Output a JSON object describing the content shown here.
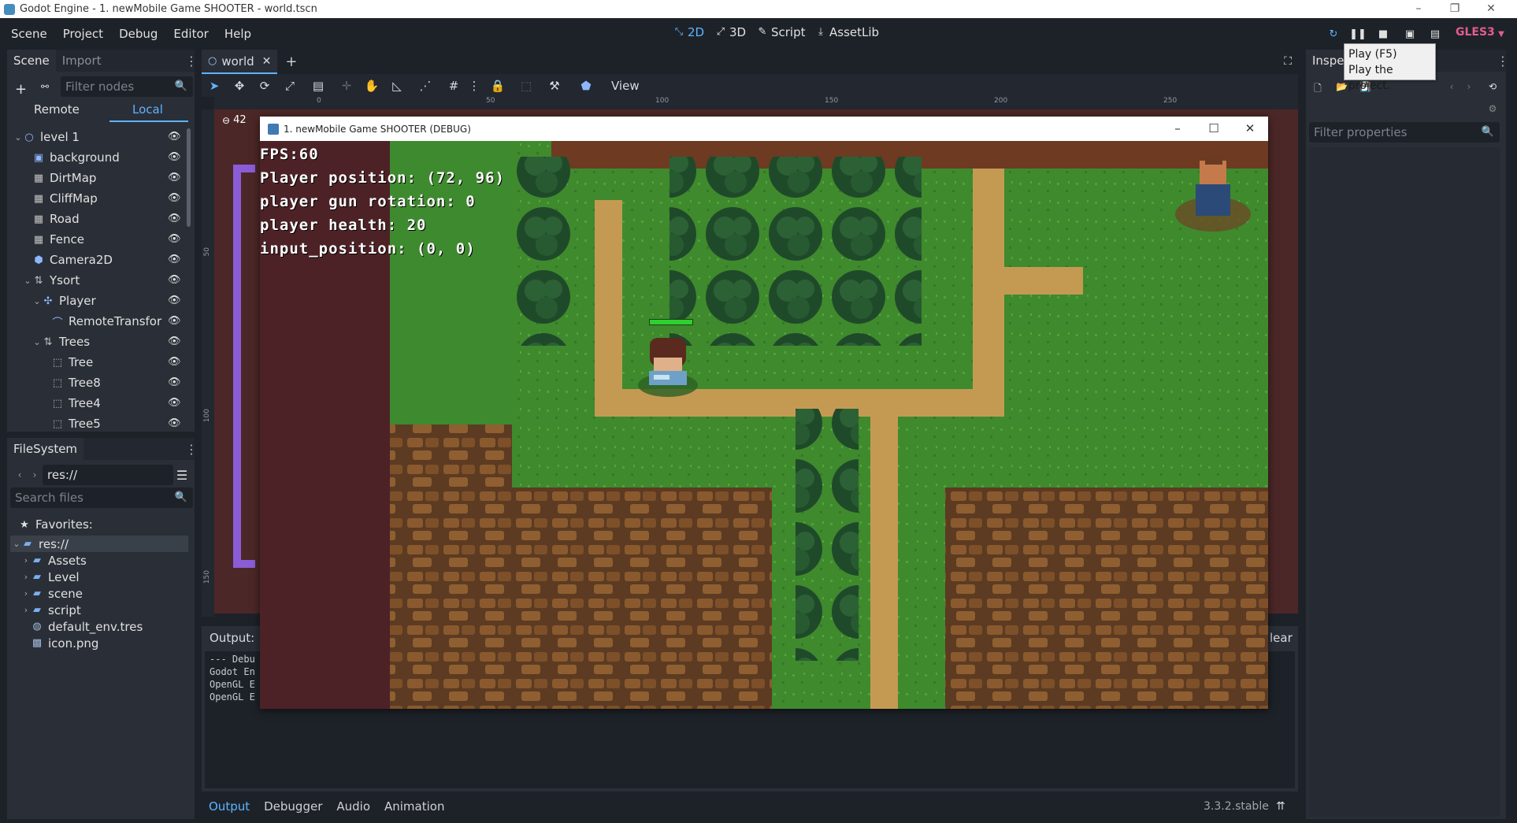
{
  "window": {
    "title": "Godot Engine - 1. newMobile Game SHOOTER - world.tscn",
    "controls": [
      "–",
      "❐",
      "✕"
    ]
  },
  "menu": {
    "items": [
      "Scene",
      "Project",
      "Debug",
      "Editor",
      "Help"
    ]
  },
  "workspaces": [
    {
      "label": "2D",
      "icon": "2d-icon",
      "active": true
    },
    {
      "label": "3D",
      "icon": "3d-icon",
      "active": false
    },
    {
      "label": "Script",
      "icon": "script-icon",
      "active": false
    },
    {
      "label": "AssetLib",
      "icon": "assetlib-icon",
      "active": false
    }
  ],
  "run_toolbar": {
    "renderer": "GLES3",
    "tooltip_line1": "Play (F5)",
    "tooltip_line2": "Play the project."
  },
  "scene_dock": {
    "tabs": [
      "Scene",
      "Import"
    ],
    "filter_placeholder": "Filter nodes",
    "remote_label": "Remote",
    "local_label": "Local",
    "nodes": [
      {
        "label": "level 1",
        "icon": "node2d-icon",
        "indent": 0,
        "expanded": true
      },
      {
        "label": "background",
        "icon": "sprite-icon",
        "indent": 1
      },
      {
        "label": "DirtMap",
        "icon": "tilemap-icon",
        "indent": 1
      },
      {
        "label": "CliffMap",
        "icon": "tilemap-icon",
        "indent": 1
      },
      {
        "label": "Road",
        "icon": "tilemap-icon",
        "indent": 1
      },
      {
        "label": "Fence",
        "icon": "tilemap-icon",
        "indent": 1
      },
      {
        "label": "Camera2D",
        "icon": "camera-icon",
        "indent": 1
      },
      {
        "label": "Ysort",
        "icon": "ysort-icon",
        "indent": 1,
        "expanded": true
      },
      {
        "label": "Player",
        "icon": "kinematic-icon",
        "indent": 2,
        "expanded": true
      },
      {
        "label": "RemoteTransfor",
        "icon": "remote-transform-icon",
        "indent": 3
      },
      {
        "label": "Trees",
        "icon": "ysort-icon",
        "indent": 2,
        "expanded": true
      },
      {
        "label": "Tree",
        "icon": "instance-icon",
        "indent": 3
      },
      {
        "label": "Tree8",
        "icon": "instance-icon",
        "indent": 3
      },
      {
        "label": "Tree4",
        "icon": "instance-icon",
        "indent": 3
      },
      {
        "label": "Tree5",
        "icon": "instance-icon",
        "indent": 3
      }
    ]
  },
  "filesystem_dock": {
    "tab": "FileSystem",
    "path": "res://",
    "search_placeholder": "Search files",
    "favorites_label": "Favorites:",
    "items": [
      {
        "label": "res://",
        "icon": "folder-icon",
        "indent": 0,
        "selected": true
      },
      {
        "label": "Assets",
        "icon": "folder-icon",
        "indent": 1
      },
      {
        "label": "Level",
        "icon": "folder-icon",
        "indent": 1
      },
      {
        "label": "scene",
        "icon": "folder-icon",
        "indent": 1
      },
      {
        "label": "script",
        "icon": "folder-icon",
        "indent": 1
      },
      {
        "label": "default_env.tres",
        "icon": "environment-icon",
        "indent": 1
      },
      {
        "label": "icon.png",
        "icon": "image-icon",
        "indent": 1
      }
    ]
  },
  "viewport": {
    "scene_tab": "world",
    "view_menu": "View",
    "zoom_partial": "42",
    "ruler_top": [
      "0",
      "50",
      "100",
      "150",
      "200",
      "250"
    ],
    "ruler_left": [
      "50",
      "100",
      "150"
    ]
  },
  "game_window": {
    "title": "1. newMobile Game SHOOTER (DEBUG)",
    "hud": [
      "FPS:60",
      "Player position: (72, 96)",
      "player gun rotation: 0",
      "player health: 20",
      "input_position: (0, 0)"
    ],
    "player_health_fraction": 1.0
  },
  "output_panel": {
    "title": "Output:",
    "clear_partial": "lear",
    "lines": [
      "--- Debu",
      "Godot En",
      "OpenGL E",
      "OpenGL E"
    ]
  },
  "bottom_tabs": [
    "Output",
    "Debugger",
    "Audio",
    "Animation"
  ],
  "version": "3.3.2.stable",
  "inspector": {
    "tab_partial": "Inspe",
    "filter_placeholder": "Filter properties"
  }
}
